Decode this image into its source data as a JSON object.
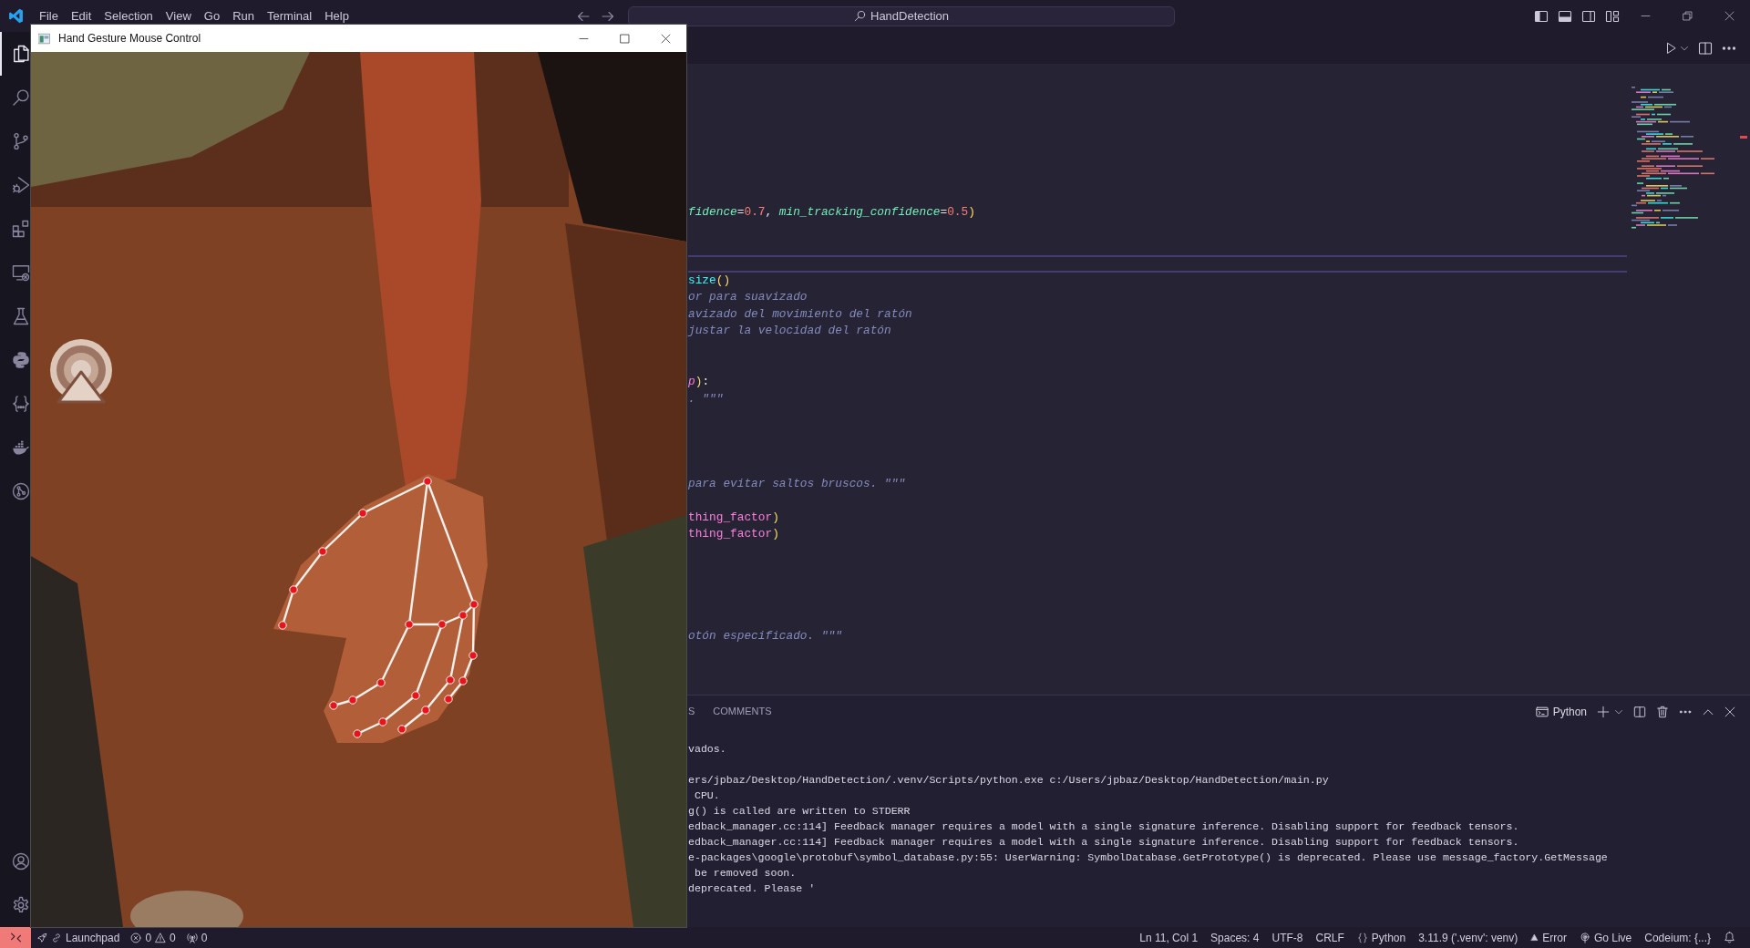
{
  "title_bar": {
    "menu": [
      "File",
      "Edit",
      "Selection",
      "View",
      "Go",
      "Run",
      "Terminal",
      "Help"
    ],
    "command_center": "HandDetection"
  },
  "activity_bar": {
    "items": [
      {
        "kind": "files",
        "selected": true
      },
      {
        "kind": "search",
        "selected": false
      },
      {
        "kind": "branch",
        "selected": false
      },
      {
        "kind": "debug",
        "selected": false
      },
      {
        "kind": "extensions",
        "selected": false
      },
      {
        "kind": "remote",
        "selected": false
      },
      {
        "kind": "flask",
        "selected": false
      },
      {
        "kind": "python",
        "selected": false
      },
      {
        "kind": "braces",
        "selected": false
      },
      {
        "kind": "whale",
        "selected": false
      },
      {
        "kind": "graph",
        "selected": false
      }
    ],
    "bottom_items": [
      {
        "kind": "account"
      },
      {
        "kind": "gear"
      }
    ]
  },
  "camera_window": {
    "title": "Hand Gesture Mouse Control"
  },
  "editor": {
    "lines": [
      {
        "kind": "blank",
        "current": false
      },
      {
        "kind": "blank",
        "current": false
      },
      {
        "kind": "blank",
        "current": false
      },
      {
        "kind": "blank",
        "current": false
      },
      {
        "kind": "blank",
        "current": false
      },
      {
        "kind": "blank",
        "current": false
      },
      {
        "kind": "blank",
        "current": false
      },
      {
        "kind": "code",
        "current": false,
        "tokens": [
          {
            "text": "fidence",
            "kind": "param"
          },
          {
            "text": "=",
            "kind": "op"
          },
          {
            "text": "0.7",
            "kind": "number"
          },
          {
            "text": ", ",
            "kind": "op"
          },
          {
            "text": "min_tracking_confidence",
            "kind": "param"
          },
          {
            "text": "=",
            "kind": "op"
          },
          {
            "text": "0.5",
            "kind": "number"
          },
          {
            "text": ")",
            "kind": "paren"
          }
        ]
      },
      {
        "kind": "blank",
        "current": false
      },
      {
        "kind": "blank",
        "current": false
      },
      {
        "kind": "blank",
        "current": true
      },
      {
        "kind": "code",
        "current": false,
        "tokens": [
          {
            "text": "size",
            "kind": "func"
          },
          {
            "text": "()",
            "kind": "paren"
          }
        ]
      },
      {
        "kind": "code",
        "current": false,
        "tokens": [
          {
            "text": "or para suavizado",
            "kind": "comment"
          }
        ]
      },
      {
        "kind": "code",
        "current": false,
        "tokens": [
          {
            "text": "avizado del movimiento del ratón",
            "kind": "comment"
          }
        ]
      },
      {
        "kind": "code",
        "current": false,
        "tokens": [
          {
            "text": "justar la velocidad del ratón",
            "kind": "comment"
          }
        ]
      },
      {
        "kind": "blank",
        "current": false
      },
      {
        "kind": "blank",
        "current": false
      },
      {
        "kind": "code",
        "current": false,
        "tokens": [
          {
            "text": "p",
            "kind": "arg"
          },
          {
            "text": ")",
            "kind": "paren"
          },
          {
            "text": ":",
            "kind": "op"
          }
        ]
      },
      {
        "kind": "code",
        "current": false,
        "tokens": [
          {
            "text": ". \"\"\"",
            "kind": "comment"
          }
        ]
      },
      {
        "kind": "blank",
        "current": false
      },
      {
        "kind": "blank",
        "current": false
      },
      {
        "kind": "blank",
        "current": false
      },
      {
        "kind": "blank",
        "current": false
      },
      {
        "kind": "code",
        "current": false,
        "tokens": [
          {
            "text": "para evitar saltos bruscos. \"\"\"",
            "kind": "comment"
          }
        ]
      },
      {
        "kind": "blank",
        "current": false
      },
      {
        "kind": "code",
        "current": false,
        "tokens": [
          {
            "text": "thing_factor",
            "kind": "var"
          },
          {
            "text": ")",
            "kind": "paren"
          }
        ]
      },
      {
        "kind": "code",
        "current": false,
        "tokens": [
          {
            "text": "thing_factor",
            "kind": "var"
          },
          {
            "text": ")",
            "kind": "paren"
          }
        ]
      },
      {
        "kind": "blank",
        "current": false
      },
      {
        "kind": "blank",
        "current": false
      },
      {
        "kind": "blank",
        "current": false
      },
      {
        "kind": "blank",
        "current": false
      },
      {
        "kind": "blank",
        "current": false
      },
      {
        "kind": "code",
        "current": false,
        "tokens": [
          {
            "text": "otón especificado. \"\"\"",
            "kind": "comment"
          }
        ]
      },
      {
        "kind": "blank",
        "current": false
      },
      {
        "kind": "blank",
        "current": false
      }
    ]
  },
  "panel": {
    "tabs": [
      {
        "label": "S",
        "selected": false
      },
      {
        "label": "COMMENTS",
        "selected": false
      }
    ],
    "terminal_profile": "Python",
    "terminal_lines": [
      {
        "kind": "output",
        "text": "vados."
      },
      {
        "kind": "blank"
      },
      {
        "kind": "output",
        "text": "ers/jpbaz/Desktop/HandDetection/.venv/Scripts/python.exe c:/Users/jpbaz/Desktop/HandDetection/main.py"
      },
      {
        "kind": "output",
        "text": " CPU."
      },
      {
        "kind": "output",
        "text": "g() is called are written to STDERR"
      },
      {
        "kind": "output",
        "text": "edback_manager.cc:114] Feedback manager requires a model with a single signature inference. Disabling support for feedback tensors."
      },
      {
        "kind": "output",
        "text": "edback_manager.cc:114] Feedback manager requires a model with a single signature inference. Disabling support for feedback tensors."
      },
      {
        "kind": "output",
        "text": "e-packages\\google\\protobuf\\symbol_database.py:55: UserWarning: SymbolDatabase.GetPrototype() is deprecated. Please use message_factory.GetMessage"
      },
      {
        "kind": "output",
        "text": " be removed soon."
      },
      {
        "kind": "output",
        "text": "deprecated. Please '"
      }
    ]
  },
  "status_bar": {
    "left": [
      {
        "kind": "remote"
      },
      {
        "kind": "launchpad",
        "text": "Launchpad"
      },
      {
        "kind": "problems",
        "errors": "0",
        "warnings": "0"
      },
      {
        "kind": "ports",
        "text": "0"
      }
    ],
    "right": [
      {
        "kind": "plain",
        "text": "Ln 11, Col 1"
      },
      {
        "kind": "plain",
        "text": "Spaces: 4"
      },
      {
        "kind": "plain",
        "text": "UTF-8"
      },
      {
        "kind": "plain",
        "text": "CRLF"
      },
      {
        "kind": "language",
        "text": "Python"
      },
      {
        "kind": "plain",
        "text": "3.11.9 ('.venv': venv)"
      },
      {
        "kind": "alert",
        "text": "Error"
      },
      {
        "kind": "live",
        "text": "Go Live"
      },
      {
        "kind": "plain",
        "text": "Codeium: {...}"
      },
      {
        "kind": "bell"
      }
    ]
  }
}
